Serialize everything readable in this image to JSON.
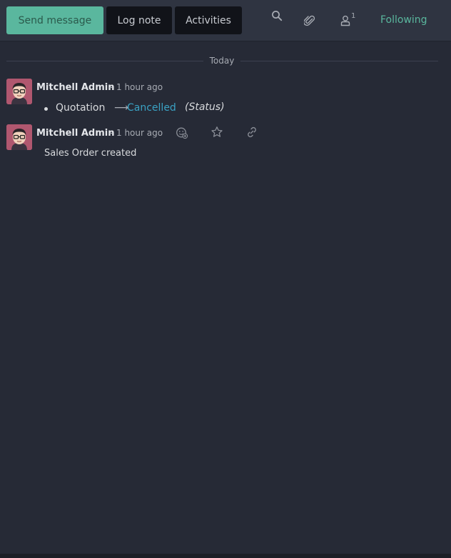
{
  "toolbar": {
    "send_message": "Send message",
    "log_note": "Log note",
    "activities": "Activities",
    "follower_count": "1",
    "following": "Following",
    "accent_color": "#5ab79e"
  },
  "icons": {
    "search": "search-icon",
    "attachment": "paperclip-icon",
    "followers": "user-icon",
    "reaction": "add-reaction-icon",
    "star": "star-icon",
    "link": "link-icon"
  },
  "date_separator": "Today",
  "messages": [
    {
      "author": "Mitchell Admin",
      "separator": "-",
      "time": "1 hour ago",
      "tracking": {
        "field": "Quotation",
        "new_value": "Cancelled",
        "field_desc": "(Status)"
      }
    },
    {
      "author": "Mitchell Admin",
      "separator": "-",
      "time": "1 hour ago",
      "body": "Sales Order created"
    }
  ]
}
